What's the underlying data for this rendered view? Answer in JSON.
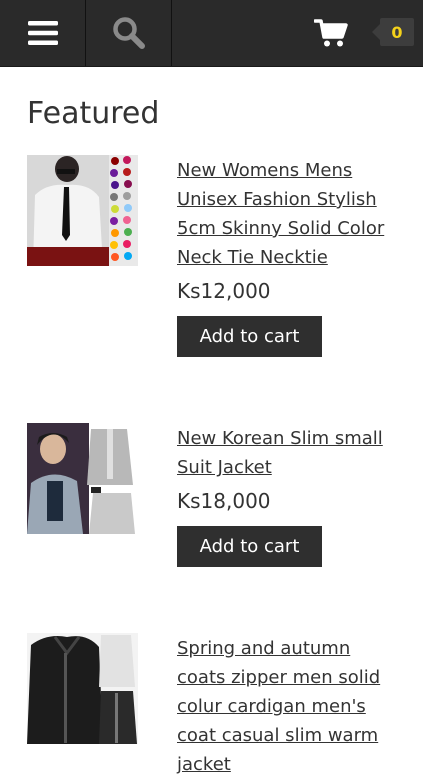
{
  "header": {
    "menu_icon": "hamburger-menu-icon",
    "search_icon": "magnifier-search-icon",
    "cart_icon": "shopping-cart-icon",
    "cart_count": "0",
    "badge_color": "#f5d21b"
  },
  "page": {
    "title": "Featured"
  },
  "products": [
    {
      "title": "New Womens Mens Unisex Fashion Stylish 5cm Skinny Solid Color Neck Tie Necktie",
      "price": "Ks12,000",
      "button": "Add to cart"
    },
    {
      "title": "New Korean Slim small Suit Jacket",
      "price": "Ks18,000",
      "button": "Add to cart"
    },
    {
      "title": "Spring and autumn coats zipper men solid colur cardigan men's coat casual slim warm jacket"
    }
  ]
}
